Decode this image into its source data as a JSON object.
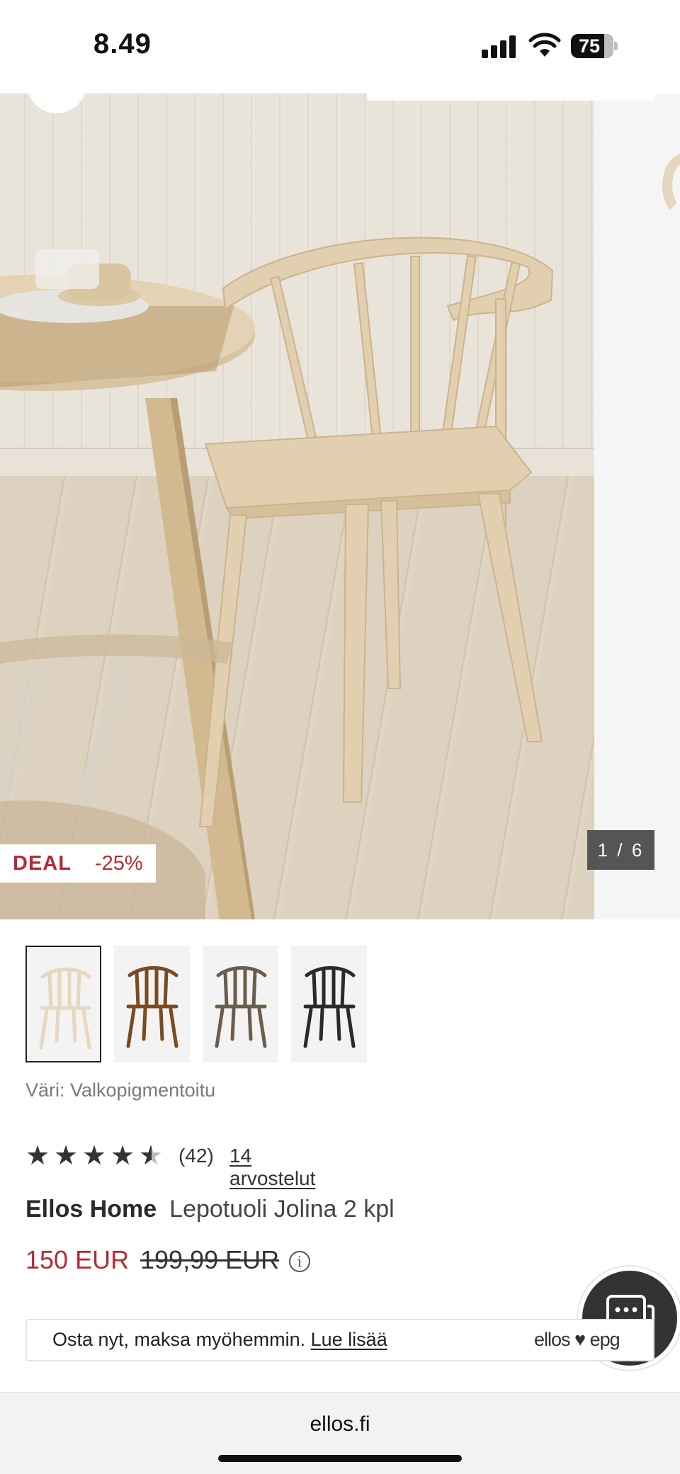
{
  "status_bar": {
    "time": "8.49",
    "battery": "75"
  },
  "gallery": {
    "badges": {
      "deal": "DEAL",
      "discount": "-25%"
    },
    "counter": "1 / 6"
  },
  "thumbnails": [
    {
      "color_name": "Valkopigmentoitu",
      "swatch": "#ece1cc",
      "selected": true
    },
    {
      "color_name": "brown",
      "swatch": "#7a4a22",
      "selected": false
    },
    {
      "color_name": "grey-brown",
      "swatch": "#6b5d4b",
      "selected": false
    },
    {
      "color_name": "black",
      "swatch": "#2a2a2a",
      "selected": false
    }
  ],
  "product": {
    "color_label": "Väri: Valkopigmentoitu",
    "rating": 4.5,
    "rating_count": "(42)",
    "reviews_link": "14 arvostelut",
    "brand": "Ellos Home",
    "name": "Lepotuoli Jolina 2 kpl",
    "price_current": "150 EUR",
    "price_old": "199,99 EUR"
  },
  "bnpl": {
    "text": "Osta nyt, maksa myöhemmin.",
    "link": "Lue lisää",
    "logo": "ellos ♥ epg"
  },
  "browser": {
    "url": "ellos.fi"
  },
  "colors": {
    "sale_red": "#b72a35",
    "text_dark": "#222222",
    "chat_bg": "#333333"
  }
}
